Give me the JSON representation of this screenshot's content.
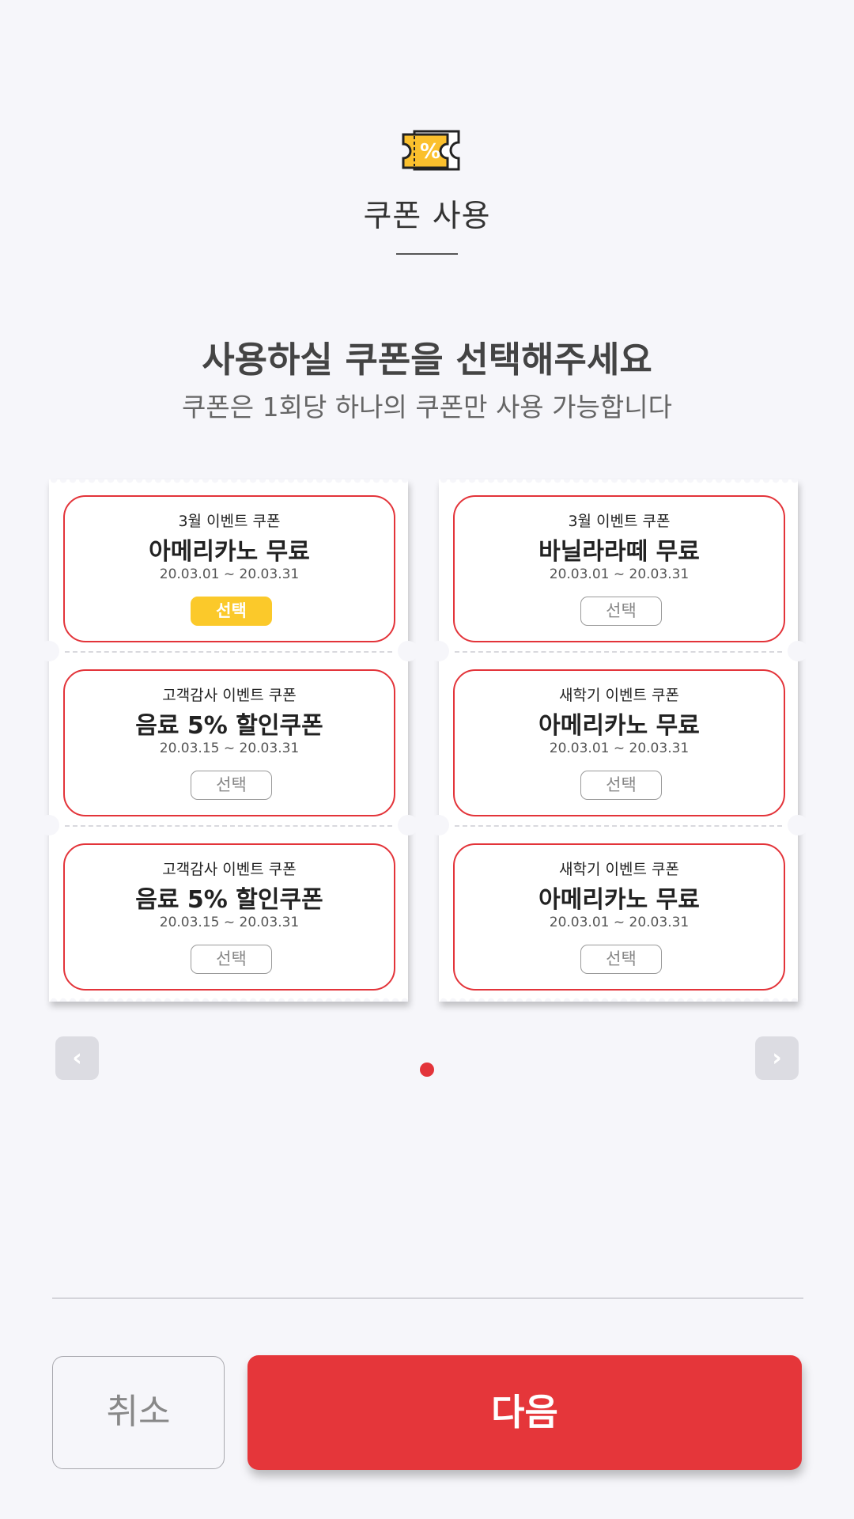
{
  "header": {
    "icon": "coupon-percent-icon",
    "icon_text": "%",
    "title": "쿠폰 사용"
  },
  "instruction": {
    "title": "사용하실 쿠폰을 선택해주세요",
    "subtitle": "쿠폰은 1회당 하나의 쿠폰만 사용 가능합니다"
  },
  "coupons": {
    "left": [
      {
        "event": "3월 이벤트 쿠폰",
        "name": "아메리카노 무료",
        "period": "20.03.01 ~ 20.03.31",
        "select_label": "선택",
        "selected": true
      },
      {
        "event": "고객감사 이벤트 쿠폰",
        "name": "음료 5% 할인쿠폰",
        "period": "20.03.15 ~ 20.03.31",
        "select_label": "선택",
        "selected": false
      },
      {
        "event": "고객감사 이벤트 쿠폰",
        "name": "음료 5% 할인쿠폰",
        "period": "20.03.15 ~ 20.03.31",
        "select_label": "선택",
        "selected": false
      }
    ],
    "right": [
      {
        "event": "3월 이벤트 쿠폰",
        "name": "바닐라라떼 무료",
        "period": "20.03.01 ~ 20.03.31",
        "select_label": "선택",
        "selected": false
      },
      {
        "event": "새학기 이벤트 쿠폰",
        "name": "아메리카노 무료",
        "period": "20.03.01 ~ 20.03.31",
        "select_label": "선택",
        "selected": false
      },
      {
        "event": "새학기 이벤트 쿠폰",
        "name": "아메리카노 무료",
        "period": "20.03.01 ~ 20.03.31",
        "select_label": "선택",
        "selected": false
      }
    ]
  },
  "pagination": {
    "prev_label": "‹",
    "next_label": "›",
    "current_page": 1,
    "total_pages": 1
  },
  "footer": {
    "cancel_label": "취소",
    "next_label": "다음"
  },
  "colors": {
    "accent_red": "#e5363a",
    "selected_yellow": "#fbc92a",
    "background": "#f6f6fa"
  }
}
